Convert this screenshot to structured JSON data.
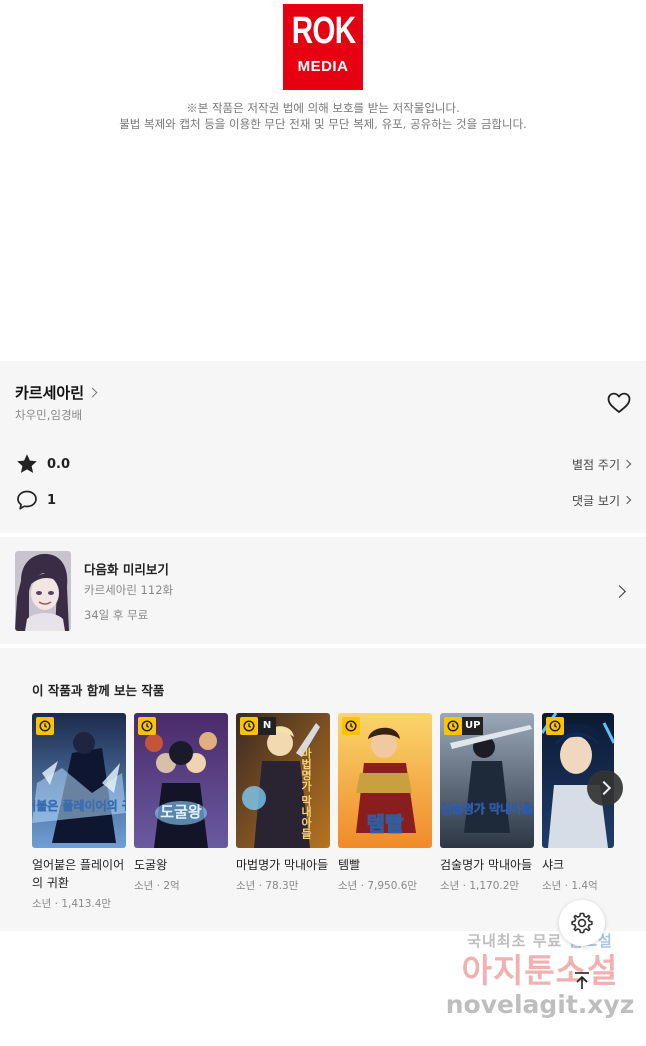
{
  "publisher": {
    "logo_line1": "ROK",
    "logo_line2": "MEDIA",
    "notice_line1": "※본 작품은 저작권 법에 의해 보호를 받는 저작물입니다.",
    "notice_line2": "불법 복제와 캡처 등을 이용한 무단 전재 및 무단 복제, 유포, 공유하는 것을 금합니다."
  },
  "work": {
    "title": "카르세아린",
    "authors": "차우민,임경배",
    "rating": "0.0",
    "rate_label": "별점 주기",
    "comment_count": "1",
    "comment_label": "댓글 보기"
  },
  "next_episode": {
    "title": "다음화 미리보기",
    "subtitle": "카르세아린 112화",
    "free_info": "34일 후 무료"
  },
  "recommendations": {
    "heading": "이 작품과 함께 보는 작품",
    "items": [
      {
        "title": "얼어붙은 플레이어의 귀환",
        "meta": "소년 · 1,413.4만",
        "badge": "",
        "cover_text": "얼어붙은 플레이어의 귀환"
      },
      {
        "title": "도굴왕",
        "meta": "소년 · 2억",
        "badge": "",
        "cover_text": "도굴왕"
      },
      {
        "title": "마법명가 막내아들",
        "meta": "소년 · 78.3만",
        "badge": "N",
        "cover_text": "마법명가 막내아들"
      },
      {
        "title": "템빨",
        "meta": "소년 · 7,950.6만",
        "badge": "",
        "cover_text": "템빨"
      },
      {
        "title": "검술명가 막내아들",
        "meta": "소년 · 1,170.2만",
        "badge": "UP",
        "cover_text": "검술명가 막내아들"
      },
      {
        "title": "샤크",
        "meta": "소년 · 1.4억",
        "badge": "",
        "cover_text": ""
      }
    ]
  },
  "watermark": {
    "line1_a": "국내최초 무료 ",
    "line1_b": "웹소설",
    "line2": "아지툰소설",
    "line3": "novelagit.xyz"
  },
  "colors": {
    "brand_red": "#e60012",
    "panel_bg": "#f6f6f6",
    "badge_yellow": "#ffc300"
  }
}
